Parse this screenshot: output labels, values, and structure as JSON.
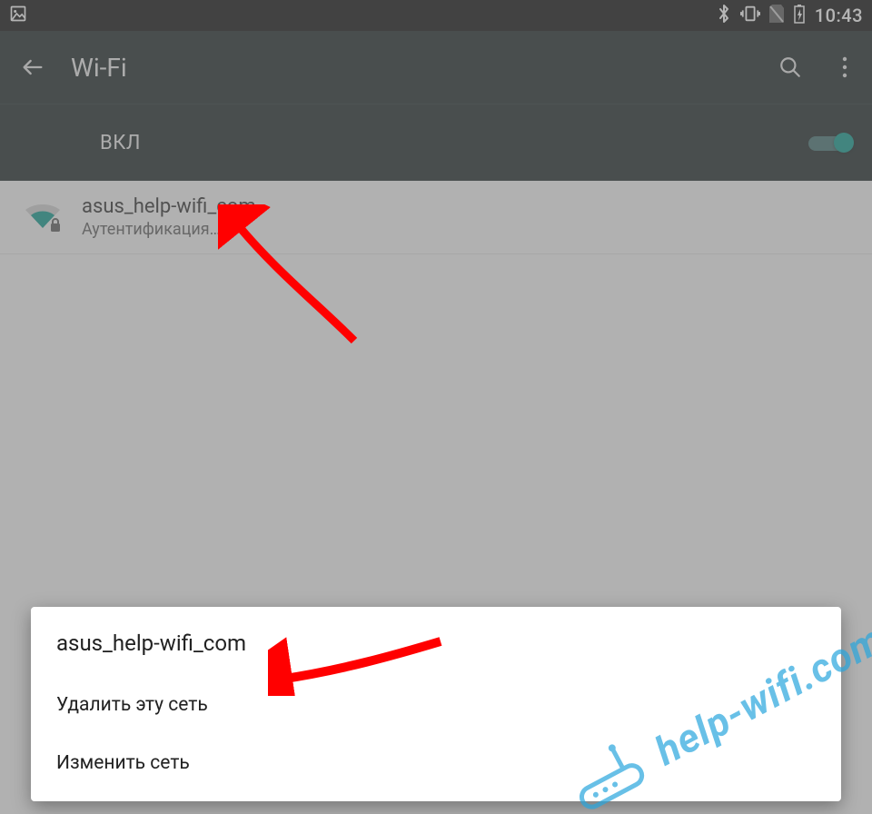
{
  "statusbar": {
    "time": "10:43"
  },
  "toolbar": {
    "title": "Wi-Fi"
  },
  "wifi_toggle": {
    "label": "ВКЛ",
    "on": true
  },
  "networks": [
    {
      "name": "asus_help-wifi_com",
      "status": "Аутентификация…"
    }
  ],
  "dialog": {
    "title": "asus_help-wifi_com",
    "options": [
      "Удалить эту сеть",
      "Изменить сеть"
    ]
  },
  "watermark": {
    "text": "help-wifi.com"
  }
}
